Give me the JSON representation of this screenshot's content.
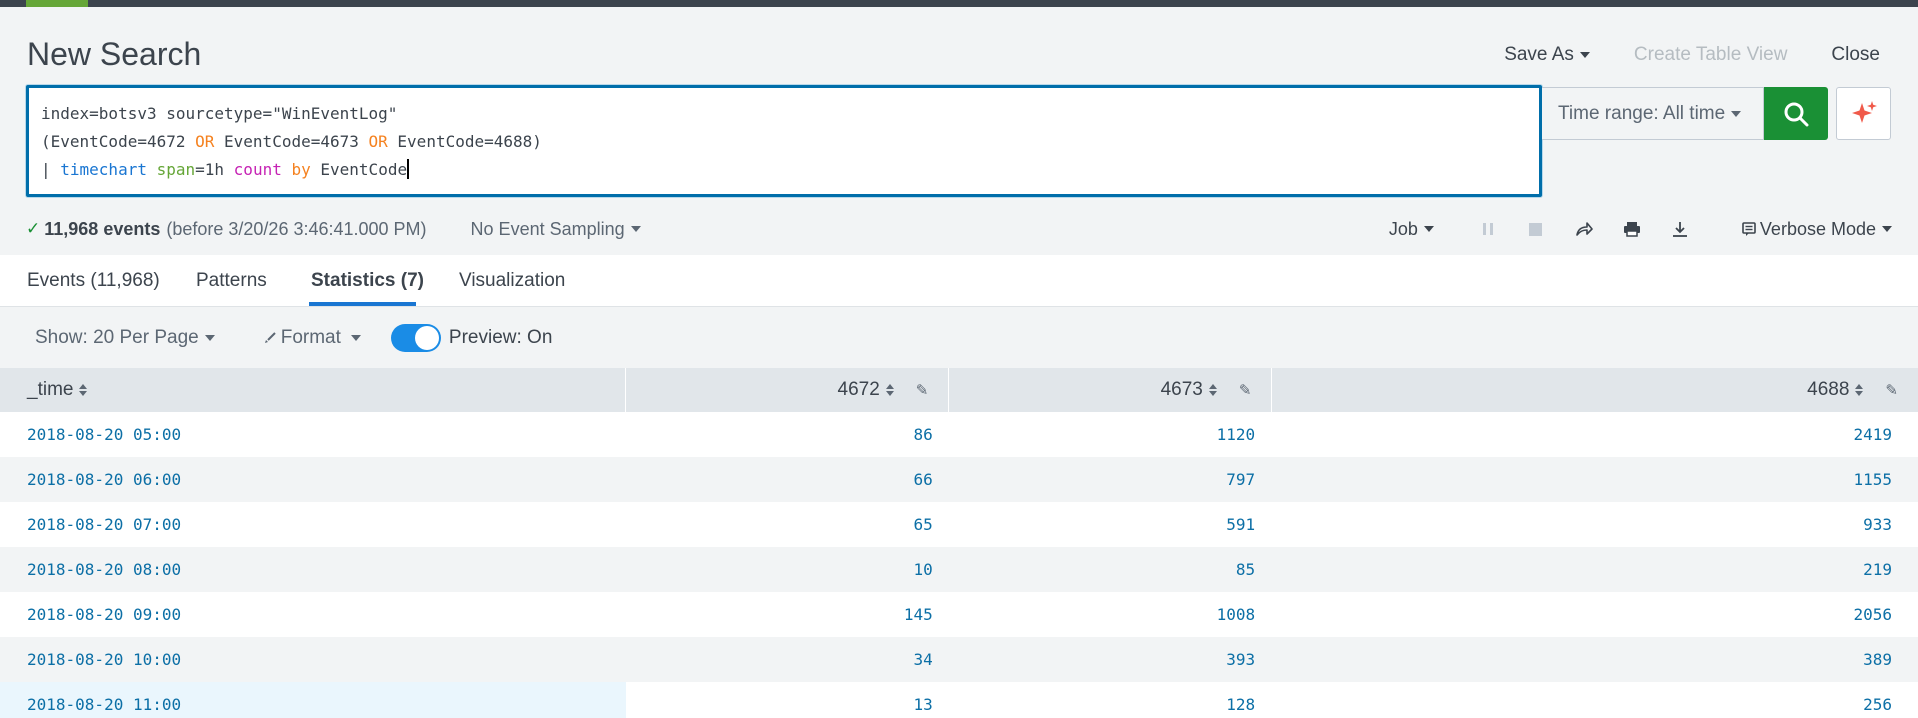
{
  "page": {
    "title": "New Search"
  },
  "header": {
    "save_as": "Save As",
    "create_table_view": "Create Table View",
    "close": "Close"
  },
  "search": {
    "line1": "index=botsv3 sourcetype=\"WinEventLog\"",
    "line2_p1": "(EventCode=4672 ",
    "line2_or1": "OR",
    "line2_p2": " EventCode=4673 ",
    "line2_or2": "OR",
    "line2_p3": " EventCode=4688)",
    "line3_pipe": "| ",
    "line3_cmd": "timechart",
    "line3_arg": "span",
    "line3_val": "=1h ",
    "line3_fn": "count",
    "line3_by": "by",
    "line3_field": "EventCode"
  },
  "time_range": {
    "label": "Time range: All time"
  },
  "status": {
    "check": "✓",
    "events": "11,968 events",
    "before": "(before 3/20/26 3:46:41.000 PM)",
    "sampling": "No Event Sampling",
    "job": "Job",
    "mode": "Verbose Mode"
  },
  "tabs": [
    {
      "label": "Events (11,968)"
    },
    {
      "label": "Patterns"
    },
    {
      "label": "Statistics (7)"
    },
    {
      "label": "Visualization"
    }
  ],
  "toolbar": {
    "show": "Show: 20 Per Page",
    "format": "Format",
    "preview": "Preview: On"
  },
  "table": {
    "columns": [
      "_time",
      "4672",
      "4673",
      "4688"
    ],
    "rows": [
      [
        "2018-08-20 05:00",
        "86",
        "1120",
        "2419"
      ],
      [
        "2018-08-20 06:00",
        "66",
        "797",
        "1155"
      ],
      [
        "2018-08-20 07:00",
        "65",
        "591",
        "933"
      ],
      [
        "2018-08-20 08:00",
        "10",
        "85",
        "219"
      ],
      [
        "2018-08-20 09:00",
        "145",
        "1008",
        "2056"
      ],
      [
        "2018-08-20 10:00",
        "34",
        "393",
        "389"
      ],
      [
        "2018-08-20 11:00",
        "13",
        "128",
        "256"
      ]
    ]
  },
  "colors": {
    "accent": "#1a76d2",
    "search_green": "#1a9035",
    "link": "#0c6fa6"
  }
}
